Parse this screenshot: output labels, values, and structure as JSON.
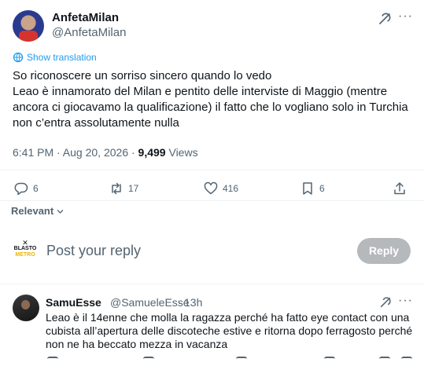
{
  "tweet": {
    "author_name": "AnfetaMilan",
    "author_handle": "@AnfetaMilan",
    "show_translation": "Show translation",
    "text": "So riconoscere un sorriso sincero quando lo vedo\nLeao è innamorato del Milan e pentito delle interviste di Maggio (mentre ancora ci giocavamo la qualificazione) il fatto che lo vogliano solo in Turchia non c’entra assolutamente nulla",
    "time": "6:41 PM · Aug 20, 2026 ·",
    "views_count": "9,499",
    "views_label": "Views",
    "replies": "6",
    "reposts": "17",
    "likes": "416",
    "bookmarks": "6"
  },
  "icons": {
    "reply": "reply-icon",
    "repost": "repost-icon",
    "like": "heart-icon",
    "bookmark": "bookmark-icon",
    "share": "share-icon",
    "grok": "grok-icon",
    "more": "more-icon",
    "translate": "globe-icon"
  },
  "sort": {
    "label": "Relevant"
  },
  "composer": {
    "logo_top": "BLASTO",
    "logo_bottom": "METRO",
    "placeholder": "Post your reply",
    "button": "Reply"
  },
  "reply": {
    "author_name": "SamuEsse",
    "author_handle": "@SamueleEsse",
    "separator": "·",
    "time": "13h",
    "text": "Leao è il 14enne che molla la ragazza perché ha fatto eye contact con una cubista all’apertura delle discoteche estive e ritorna dopo ferragosto perché non ne ha beccato mezza in vacanza"
  },
  "colors": {
    "accent": "#1d9bf0",
    "muted": "#536471",
    "text": "#0f1419",
    "reply_button_disabled": "#b6b9bc"
  }
}
